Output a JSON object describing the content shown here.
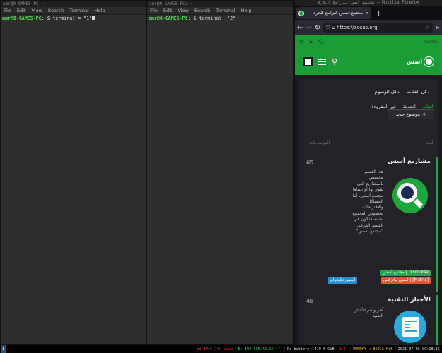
{
  "terminal1": {
    "title": "amr@0-GAMES-PC: ~",
    "menu": [
      "File",
      "Edit",
      "View",
      "Search",
      "Terminal",
      "Help"
    ],
    "prompt_user": "amr@0-GAMES-PC",
    "prompt_path": ":~$ ",
    "command": "terminal = \"1\""
  },
  "terminal2": {
    "title": "amr@0-GAMES-PC: ~",
    "menu": [
      "File",
      "Edit",
      "View",
      "Search",
      "Terminal",
      "Help"
    ],
    "prompt_user": "amr@0-GAMES-PC",
    "prompt_path": ":~$ ",
    "command": "terminal  \"2\""
  },
  "firefox": {
    "window_title": "مجتمع أسس البرامج الحرة — Mozilla Firefox",
    "tab_title": "مجتمع أسس البرامج الحره",
    "new_tab": "+",
    "url": "https://aosus.org",
    "overflow": "»",
    "site": {
      "matrix_link": "Matrix",
      "brand": "أسس",
      "filters": [
        "كل الفئات",
        "كل الوسوم"
      ],
      "tabs": [
        {
          "label": "الفئات",
          "active": true
        },
        {
          "label": "الحديثة",
          "active": false
        },
        {
          "label": "غير المقروءة",
          "active": false
        }
      ],
      "new_topic": "موضوع جديد",
      "col_category": "الفئة",
      "col_topics": "الموضوعات",
      "categories": [
        {
          "title": "مشاريع أسس",
          "count": "65",
          "description": "هذا القسم مخصص بالمشاريع التي يقوم بها أو يتبناها مجتمع أسس، أما المشاكل والاقتراحات بخصوص المجتمع نفسه فتكون في القسم الفرعي \"مجتمع أسس\".",
          "subcategories": [
            {
              "label": "مجتمع أسس | Discourse",
              "color": "#27a844"
            },
            {
              "label": "أسس ماتركس | [Matrix]",
              "color": "#e4572e"
            },
            {
              "label": "أسس تيليجرام",
              "color": "#2b8fd6"
            }
          ]
        },
        {
          "title": "الأخبار التقنية",
          "count": "48",
          "description": "آخر وأهم الأخبار التقنية"
        }
      ]
    }
  },
  "taskbar": {
    "workspace": "1",
    "status": [
      {
        "text": "no IPv6",
        "color": "red"
      },
      {
        "text": "W: down",
        "color": "red"
      },
      {
        "text": "E: 192.168.42.16 (?)",
        "color": "green"
      },
      {
        "text": "No battery",
        "color": "white"
      },
      {
        "text": "419.6 GiB",
        "color": "white"
      },
      {
        "text": "1.61",
        "color": "red"
      },
      {
        "text": "MEMORY < 890.6 MiB",
        "color": "yellow"
      },
      {
        "text": "2021-07-06 09:18:15",
        "color": "white"
      }
    ]
  }
}
